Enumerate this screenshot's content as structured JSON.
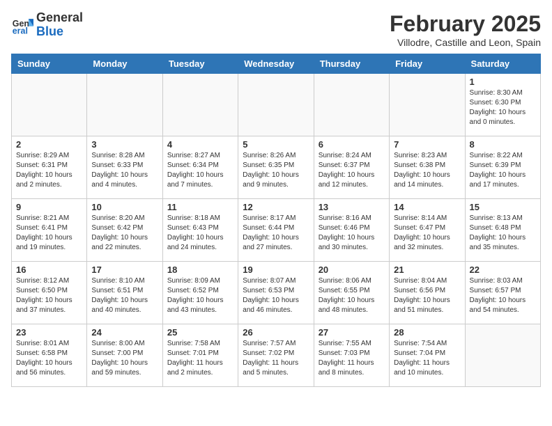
{
  "header": {
    "logo_general": "General",
    "logo_blue": "Blue",
    "month": "February 2025",
    "location": "Villodre, Castille and Leon, Spain"
  },
  "days_of_week": [
    "Sunday",
    "Monday",
    "Tuesday",
    "Wednesday",
    "Thursday",
    "Friday",
    "Saturday"
  ],
  "weeks": [
    [
      {
        "day": "",
        "info": ""
      },
      {
        "day": "",
        "info": ""
      },
      {
        "day": "",
        "info": ""
      },
      {
        "day": "",
        "info": ""
      },
      {
        "day": "",
        "info": ""
      },
      {
        "day": "",
        "info": ""
      },
      {
        "day": "1",
        "info": "Sunrise: 8:30 AM\nSunset: 6:30 PM\nDaylight: 10 hours and 0 minutes."
      }
    ],
    [
      {
        "day": "2",
        "info": "Sunrise: 8:29 AM\nSunset: 6:31 PM\nDaylight: 10 hours and 2 minutes."
      },
      {
        "day": "3",
        "info": "Sunrise: 8:28 AM\nSunset: 6:33 PM\nDaylight: 10 hours and 4 minutes."
      },
      {
        "day": "4",
        "info": "Sunrise: 8:27 AM\nSunset: 6:34 PM\nDaylight: 10 hours and 7 minutes."
      },
      {
        "day": "5",
        "info": "Sunrise: 8:26 AM\nSunset: 6:35 PM\nDaylight: 10 hours and 9 minutes."
      },
      {
        "day": "6",
        "info": "Sunrise: 8:24 AM\nSunset: 6:37 PM\nDaylight: 10 hours and 12 minutes."
      },
      {
        "day": "7",
        "info": "Sunrise: 8:23 AM\nSunset: 6:38 PM\nDaylight: 10 hours and 14 minutes."
      },
      {
        "day": "8",
        "info": "Sunrise: 8:22 AM\nSunset: 6:39 PM\nDaylight: 10 hours and 17 minutes."
      }
    ],
    [
      {
        "day": "9",
        "info": "Sunrise: 8:21 AM\nSunset: 6:41 PM\nDaylight: 10 hours and 19 minutes."
      },
      {
        "day": "10",
        "info": "Sunrise: 8:20 AM\nSunset: 6:42 PM\nDaylight: 10 hours and 22 minutes."
      },
      {
        "day": "11",
        "info": "Sunrise: 8:18 AM\nSunset: 6:43 PM\nDaylight: 10 hours and 24 minutes."
      },
      {
        "day": "12",
        "info": "Sunrise: 8:17 AM\nSunset: 6:44 PM\nDaylight: 10 hours and 27 minutes."
      },
      {
        "day": "13",
        "info": "Sunrise: 8:16 AM\nSunset: 6:46 PM\nDaylight: 10 hours and 30 minutes."
      },
      {
        "day": "14",
        "info": "Sunrise: 8:14 AM\nSunset: 6:47 PM\nDaylight: 10 hours and 32 minutes."
      },
      {
        "day": "15",
        "info": "Sunrise: 8:13 AM\nSunset: 6:48 PM\nDaylight: 10 hours and 35 minutes."
      }
    ],
    [
      {
        "day": "16",
        "info": "Sunrise: 8:12 AM\nSunset: 6:50 PM\nDaylight: 10 hours and 37 minutes."
      },
      {
        "day": "17",
        "info": "Sunrise: 8:10 AM\nSunset: 6:51 PM\nDaylight: 10 hours and 40 minutes."
      },
      {
        "day": "18",
        "info": "Sunrise: 8:09 AM\nSunset: 6:52 PM\nDaylight: 10 hours and 43 minutes."
      },
      {
        "day": "19",
        "info": "Sunrise: 8:07 AM\nSunset: 6:53 PM\nDaylight: 10 hours and 46 minutes."
      },
      {
        "day": "20",
        "info": "Sunrise: 8:06 AM\nSunset: 6:55 PM\nDaylight: 10 hours and 48 minutes."
      },
      {
        "day": "21",
        "info": "Sunrise: 8:04 AM\nSunset: 6:56 PM\nDaylight: 10 hours and 51 minutes."
      },
      {
        "day": "22",
        "info": "Sunrise: 8:03 AM\nSunset: 6:57 PM\nDaylight: 10 hours and 54 minutes."
      }
    ],
    [
      {
        "day": "23",
        "info": "Sunrise: 8:01 AM\nSunset: 6:58 PM\nDaylight: 10 hours and 56 minutes."
      },
      {
        "day": "24",
        "info": "Sunrise: 8:00 AM\nSunset: 7:00 PM\nDaylight: 10 hours and 59 minutes."
      },
      {
        "day": "25",
        "info": "Sunrise: 7:58 AM\nSunset: 7:01 PM\nDaylight: 11 hours and 2 minutes."
      },
      {
        "day": "26",
        "info": "Sunrise: 7:57 AM\nSunset: 7:02 PM\nDaylight: 11 hours and 5 minutes."
      },
      {
        "day": "27",
        "info": "Sunrise: 7:55 AM\nSunset: 7:03 PM\nDaylight: 11 hours and 8 minutes."
      },
      {
        "day": "28",
        "info": "Sunrise: 7:54 AM\nSunset: 7:04 PM\nDaylight: 11 hours and 10 minutes."
      },
      {
        "day": "",
        "info": ""
      }
    ]
  ]
}
